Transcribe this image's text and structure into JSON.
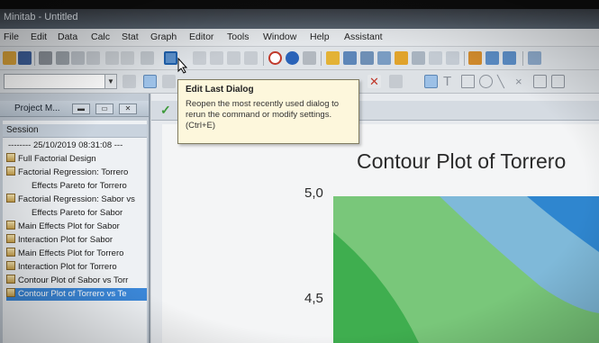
{
  "app": {
    "title": "Minitab - Untitled"
  },
  "menu": [
    "File",
    "Edit",
    "Data",
    "Calc",
    "Stat",
    "Graph",
    "Editor",
    "Tools",
    "Window",
    "Help",
    "Assistant"
  ],
  "tooltip": {
    "title": "Edit Last Dialog",
    "body": "Reopen the most recently used dialog to rerun the command or modify settings. (Ctrl+E)"
  },
  "project": {
    "title": "Project M...",
    "session_label": "Session",
    "timestamp": "-------- 25/10/2019 08:31:08  ---",
    "items": [
      {
        "label": "Full Factorial Design",
        "level": 0
      },
      {
        "label": "Factorial Regression: Torrero",
        "level": 0
      },
      {
        "label": "Effects Pareto for Torrero",
        "level": 1
      },
      {
        "label": "Factorial Regression: Sabor vs",
        "level": 0
      },
      {
        "label": "Effects Pareto for Sabor",
        "level": 1
      },
      {
        "label": "Main Effects Plot for Sabor",
        "level": 0
      },
      {
        "label": "Interaction Plot for Sabor",
        "level": 0
      },
      {
        "label": "Main Effects Plot for Torrero",
        "level": 0
      },
      {
        "label": "Interaction Plot for Torrero",
        "level": 0
      },
      {
        "label": "Contour Plot of Sabor vs Torr",
        "level": 0
      },
      {
        "label": "Contour Plot of Torrero vs Te",
        "level": 0,
        "selected": true
      }
    ]
  },
  "graph": {
    "title": "Contour Plot of Torrero",
    "yticks": [
      "5,0",
      "4,5"
    ]
  },
  "colors": {
    "contour_dark_green": "#3fae4f",
    "contour_light_green": "#79c77a",
    "contour_pale_blue": "#7fb9d9",
    "contour_blue": "#2f86cf",
    "selection": "#3b87d8",
    "tooltip_bg": "#fdf7dc"
  }
}
